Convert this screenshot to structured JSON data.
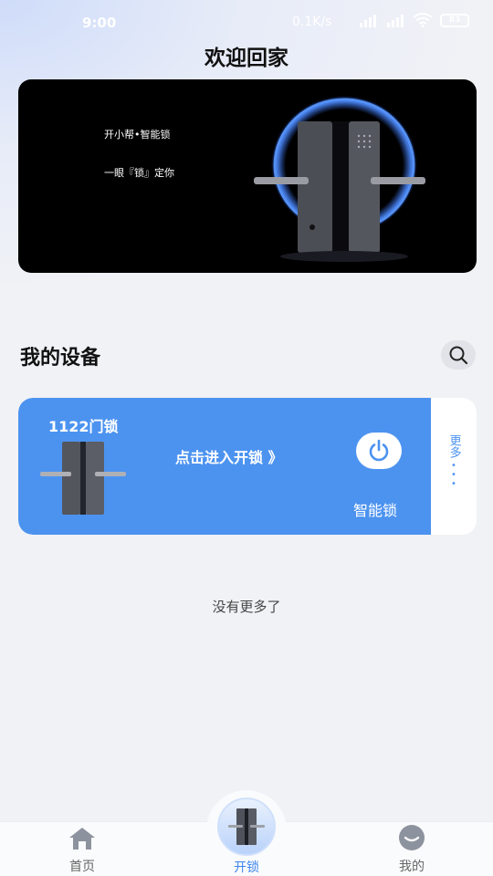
{
  "status_bar": {
    "time": "9:00",
    "net_speed": "0.1K/s",
    "battery": "83"
  },
  "page": {
    "title": "欢迎回家"
  },
  "banner": {
    "line1": "开小帮•智能锁",
    "line2": "一眼『锁』定你"
  },
  "devices_section": {
    "title": "我的设备",
    "search_icon": "search-icon"
  },
  "device_card": {
    "name": "1122门锁",
    "enter_label": "点击进入开锁 》",
    "type": "智能锁",
    "more_label": "更多",
    "more_dots": "• • •",
    "accent_color": "#4c93f0"
  },
  "empty_note": "没有更多了",
  "tabbar": {
    "home": "首页",
    "unlock": "开锁",
    "me": "我的",
    "active_color": "#3e86ee"
  }
}
